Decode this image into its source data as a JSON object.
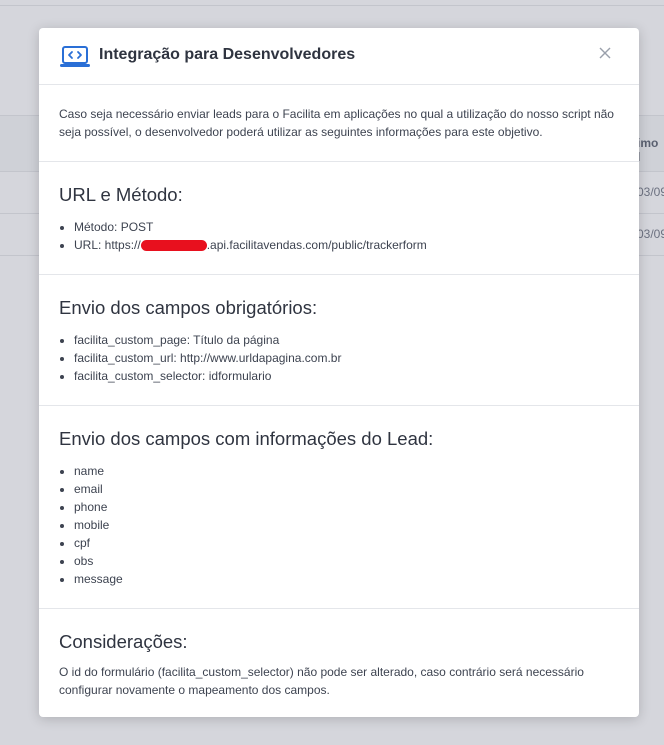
{
  "background": {
    "col_header": "imo l",
    "row1_date": "03/09",
    "row2_date": "03/09"
  },
  "modal": {
    "title": "Integração para Desenvolvedores",
    "intro": "Caso seja necessário enviar leads para o Facilita em aplicações no qual a utilização do nosso script não seja possível, o desenvolvedor poderá utilizar as seguintes informações para este objetivo.",
    "url_section": {
      "title": "URL e Método:",
      "method": "Método: POST",
      "url_prefix": "URL: https://",
      "url_suffix": ".api.facilitavendas.com/public/trackerform"
    },
    "required_section": {
      "title": "Envio dos campos obrigatórios:",
      "items": [
        "facilita_custom_page: Título da página",
        "facilita_custom_url: http://www.urldapagina.com.br",
        "facilita_custom_selector: idformulario"
      ]
    },
    "lead_section": {
      "title": "Envio dos campos com informações do Lead:",
      "items": [
        "name",
        "email",
        "phone",
        "mobile",
        "cpf",
        "obs",
        "message"
      ]
    },
    "considerations": {
      "title": "Considerações:",
      "text": "O id do formulário (facilita_custom_selector) não pode ser alterado, caso contrário será necessário configurar novamente o mapeamento dos campos."
    }
  },
  "colors": {
    "redaction": "#e8101e",
    "accent_icon": "#2a6fd6"
  }
}
